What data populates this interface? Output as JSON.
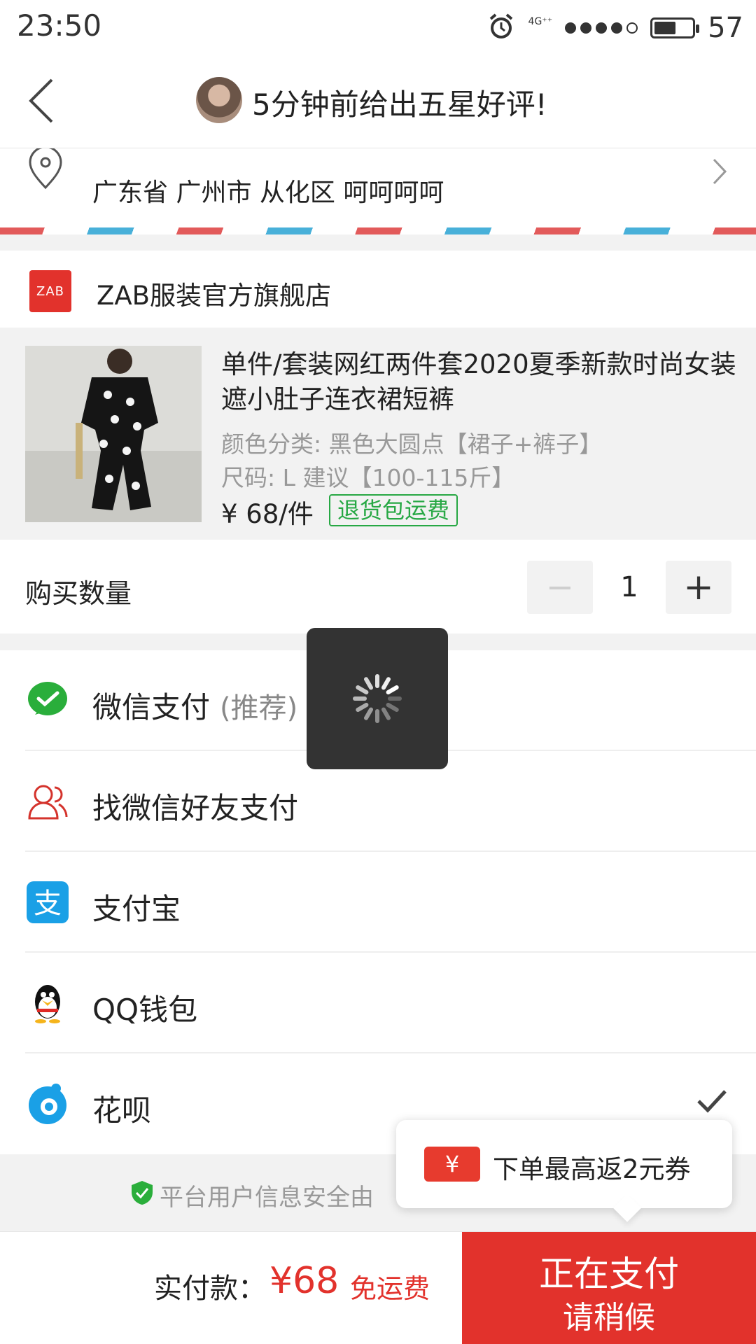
{
  "status_bar": {
    "time": "23:50",
    "network": "4G⁺⁺",
    "battery": "57",
    "battery_fill_fraction": 0.57
  },
  "header": {
    "title": "5分钟前给出五星好评!"
  },
  "address": {
    "text": "广东省 广州市 从化区 呵呵呵呵"
  },
  "shop": {
    "logo_text": "ZAB",
    "name": "ZAB服装官方旗舰店"
  },
  "product": {
    "title": "单件/套装网红两件套2020夏季新款时尚女装遮小肚子连衣裙短裤",
    "color": "颜色分类: 黑色大圆点【裙子+裤子】",
    "size": "尺码: L 建议【100-115斤】",
    "price": "¥ 68/件",
    "badge": "退货包运费"
  },
  "quantity": {
    "label": "购买数量",
    "minus": "−",
    "value": "1",
    "plus": "+"
  },
  "payment_methods": [
    {
      "label": "微信支付",
      "sub": "(推荐)",
      "icon": "wechat-pay-icon"
    },
    {
      "label": "找微信好友支付",
      "sub": "",
      "icon": "friend-icon"
    },
    {
      "label": "支付宝",
      "sub": "",
      "icon": "alipay-icon"
    },
    {
      "label": "QQ钱包",
      "sub": "",
      "icon": "qq-icon"
    },
    {
      "label": "花呗",
      "sub": "",
      "icon": "huabei-icon",
      "selected": true
    }
  ],
  "security": {
    "text": "平台用户信息安全由"
  },
  "coupon": {
    "icon_text": "¥",
    "text": "下单最高返2元券"
  },
  "bottom": {
    "total_label": "实付款：",
    "total_amount": "¥68",
    "free_shipping": "免运费",
    "pay_button_line1": "正在支付",
    "pay_button_line2": "请稍候"
  },
  "colors": {
    "accent_red": "#e2322c",
    "badge_green": "#27a844",
    "wechat_green": "#2aae3b",
    "alipay_blue": "#1aa0e6"
  }
}
